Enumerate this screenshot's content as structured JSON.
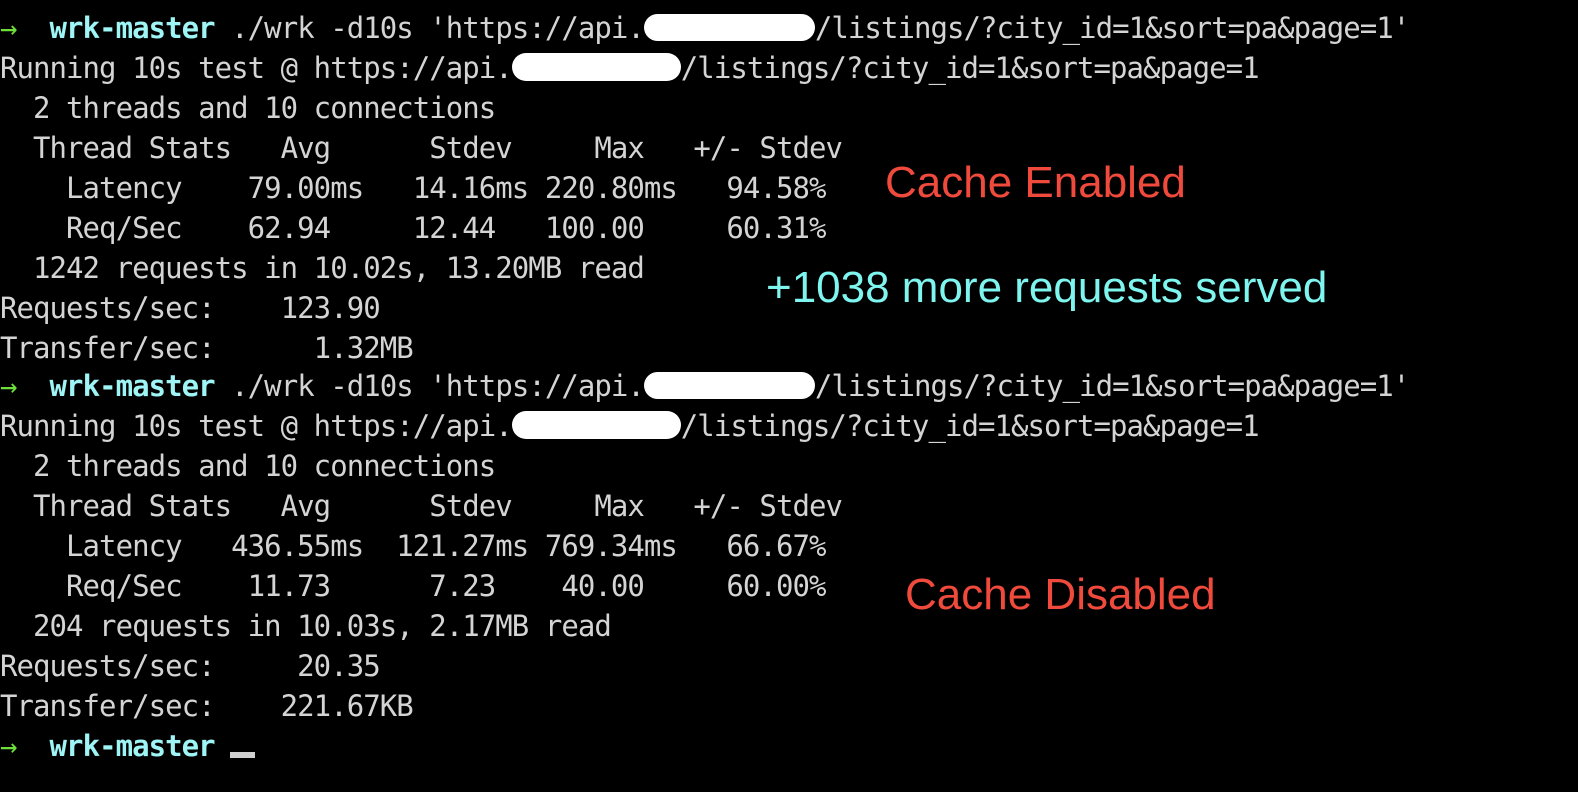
{
  "terminal": {
    "background_color": "#000000",
    "foreground_color": "#d4d4d4",
    "prompt_arrow": "→",
    "prompt_arrow_color": "#6fdd3a",
    "prompt_dir": "wrk-master",
    "prompt_dir_color": "#9ff4f5",
    "cursor": "_"
  },
  "run1": {
    "command": " ./wrk -d10s 'https://api.",
    "command_tail": "/listings/?city_id=1&sort=pa&page=1'",
    "running_prefix": "Running 10s test @ https://api.",
    "running_tail": "/listings/?city_id=1&sort=pa&page=1",
    "threads_line": "  2 threads and 10 connections",
    "stats_header": "  Thread Stats   Avg      Stdev     Max   +/- Stdev",
    "latency_line": "    Latency    79.00ms   14.16ms 220.80ms   94.58%",
    "reqsec_line": "    Req/Sec    62.94     12.44   100.00     60.31%",
    "requests_line": "  1242 requests in 10.02s, 13.20MB read",
    "requests_per_sec_line": "Requests/sec:    123.90",
    "transfer_per_sec_line": "Transfer/sec:      1.32MB",
    "stats": {
      "thread_stats": {
        "columns": [
          "Thread Stats",
          "Avg",
          "Stdev",
          "Max",
          "+/- Stdev"
        ],
        "rows": [
          {
            "label": "Latency",
            "avg": "79.00ms",
            "stdev": "14.16ms",
            "max": "220.80ms",
            "pm_stdev": "94.58%"
          },
          {
            "label": "Req/Sec",
            "avg": "62.94",
            "stdev": "12.44",
            "max": "100.00",
            "pm_stdev": "60.31%"
          }
        ]
      },
      "total_requests": "1242",
      "duration": "10.02s",
      "data_read": "13.20MB",
      "requests_per_sec": "123.90",
      "transfer_per_sec": "1.32MB",
      "threads": "2",
      "connections": "10"
    }
  },
  "run2": {
    "command": " ./wrk -d10s 'https://api.",
    "command_tail": "/listings/?city_id=1&sort=pa&page=1'",
    "running_prefix": "Running 10s test @ https://api.",
    "running_tail": "/listings/?city_id=1&sort=pa&page=1",
    "threads_line": "  2 threads and 10 connections",
    "stats_header": "  Thread Stats   Avg      Stdev     Max   +/- Stdev",
    "latency_line": "    Latency   436.55ms  121.27ms 769.34ms   66.67%",
    "reqsec_line": "    Req/Sec    11.73      7.23    40.00     60.00%",
    "requests_line": "  204 requests in 10.03s, 2.17MB read",
    "requests_per_sec_line": "Requests/sec:     20.35",
    "transfer_per_sec_line": "Transfer/sec:    221.67KB",
    "stats": {
      "thread_stats": {
        "columns": [
          "Thread Stats",
          "Avg",
          "Stdev",
          "Max",
          "+/- Stdev"
        ],
        "rows": [
          {
            "label": "Latency",
            "avg": "436.55ms",
            "stdev": "121.27ms",
            "max": "769.34ms",
            "pm_stdev": "66.67%"
          },
          {
            "label": "Req/Sec",
            "avg": "11.73",
            "stdev": "7.23",
            "max": "40.00",
            "pm_stdev": "60.00%"
          }
        ]
      },
      "total_requests": "204",
      "duration": "10.03s",
      "data_read": "2.17MB",
      "requests_per_sec": "20.35",
      "transfer_per_sec": "221.67KB",
      "threads": "2",
      "connections": "10"
    }
  },
  "annotations": {
    "cache_enabled": "Cache Enabled",
    "cache_enabled_color": "#f04a3c",
    "delta_requests": "+1038 more requests served",
    "delta_requests_color": "#7ef5ee",
    "cache_disabled": "Cache Disabled",
    "cache_disabled_color": "#f04a3c"
  }
}
